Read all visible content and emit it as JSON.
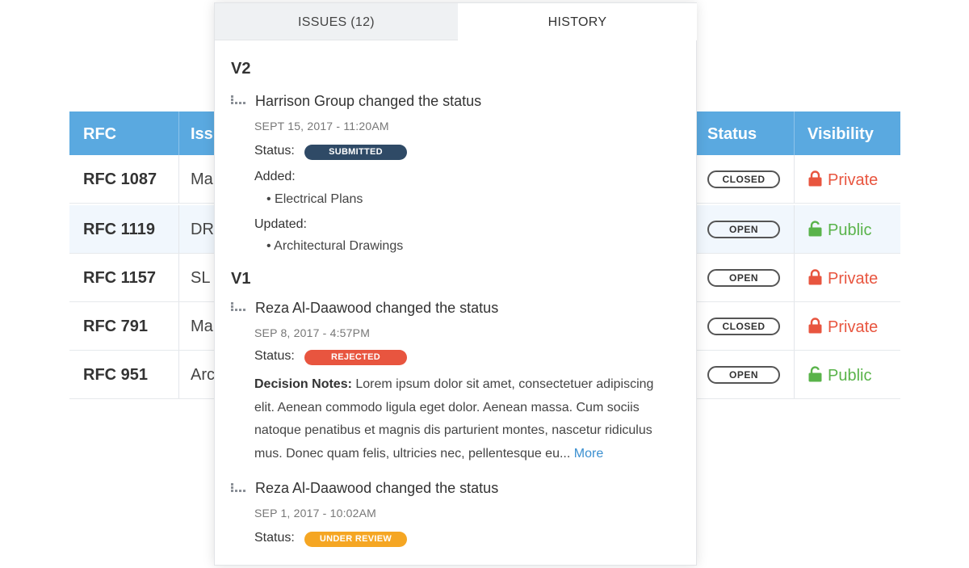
{
  "table": {
    "headers": {
      "rfc": "RFC",
      "issue": "Issu",
      "status": "Status",
      "visibility": "Visibility"
    },
    "rows": [
      {
        "id": "RFC 1087",
        "issue": "Ma",
        "status": "CLOSED",
        "visibility": "Private"
      },
      {
        "id": "RFC 1119",
        "issue": "DR/",
        "status": "OPEN",
        "visibility": "Public"
      },
      {
        "id": "RFC 1157",
        "issue": "SL (",
        "status": "OPEN",
        "visibility": "Private"
      },
      {
        "id": "RFC 791",
        "issue": "Ma",
        "status": "CLOSED",
        "visibility": "Private"
      },
      {
        "id": "RFC 951",
        "issue": "Arc",
        "status": "OPEN",
        "visibility": "Public"
      }
    ]
  },
  "tabs": {
    "issues": "ISSUES (12)",
    "history": "HISTORY"
  },
  "history": {
    "v2": {
      "heading": "V2",
      "entry": {
        "title": "Harrison Group changed the status",
        "date": "SEPT 15, 2017 - 11:20AM",
        "status_label": "Status:",
        "status": "SUBMITTED",
        "added_label": "Added:",
        "added": [
          "Electrical Plans"
        ],
        "updated_label": "Updated:",
        "updated": [
          "Architectural Drawings"
        ]
      }
    },
    "v1": {
      "heading": "V1",
      "entries": [
        {
          "title": "Reza Al-Daawood changed the status",
          "date": "SEP 8, 2017 - 4:57PM",
          "status_label": "Status:",
          "status": "REJECTED",
          "notes_label": "Decision Notes:",
          "notes": "Lorem ipsum dolor sit amet, consectetuer adipiscing elit. Aenean commodo ligula eget dolor. Aenean massa. Cum sociis natoque penatibus et magnis dis parturient montes, nascetur ridiculus mus. Donec quam felis, ultricies nec, pellentesque eu...",
          "more": "More"
        },
        {
          "title": "Reza Al-Daawood changed the status",
          "date": "SEP 1, 2017 - 10:02AM",
          "status_label": "Status:",
          "status": "UNDER REVIEW"
        }
      ]
    }
  },
  "colors": {
    "header_blue": "#5aa9e0",
    "submitted": "#2f4a66",
    "rejected": "#e8553f",
    "under_review": "#f5a623",
    "private": "#e8553f",
    "public": "#59b34a",
    "link": "#3a8fd0"
  },
  "icons": {
    "private": "lock-closed-icon",
    "public": "lock-open-icon",
    "entry": "history-entry-icon"
  }
}
